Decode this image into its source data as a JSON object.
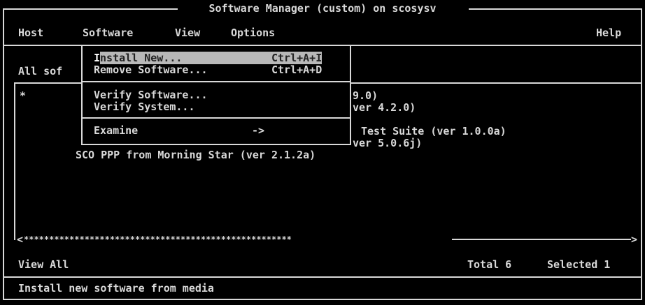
{
  "window": {
    "title": "Software Manager (custom) on scosysv"
  },
  "menubar": {
    "host": "Host",
    "software": "Software",
    "view": "View",
    "options": "Options",
    "help": "Help"
  },
  "main": {
    "heading_partial": "All sof",
    "list_marker": "*",
    "rows": [
      "9.0)",
      "ver 4.2.0)",
      "Test Suite (ver 1.0.0a)",
      "ver 5.0.6j)",
      "SCO PPP from Morning Star (ver 2.1.2a)"
    ],
    "scroll_left": "<",
    "scroll_track": "*****************************************************",
    "scroll_right": ">"
  },
  "software_menu": {
    "items": [
      {
        "label_first": "I",
        "label_rest": "nstall New...",
        "shortcut": "Ctrl+A+I"
      },
      {
        "label": "Remove Software...",
        "shortcut": "Ctrl+A+D"
      },
      {
        "label": "Verify Software..."
      },
      {
        "label": "Verify System..."
      },
      {
        "label": "Examine",
        "shortcut": "->"
      }
    ]
  },
  "status": {
    "view": "View All",
    "total": "Total 6",
    "selected": "Selected 1"
  },
  "hint": "Install new software from media"
}
